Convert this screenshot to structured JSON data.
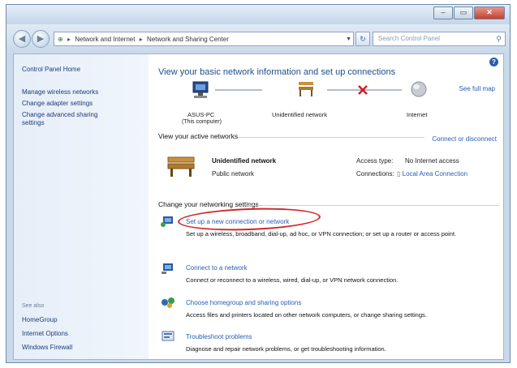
{
  "window": {
    "minimize_label": "–",
    "maximize_label": "▭",
    "close_label": "✕"
  },
  "address": {
    "crumbs": [
      "Network and Internet",
      "Network and Sharing Center"
    ],
    "search_placeholder": "Search Control Panel"
  },
  "sidebar": {
    "home": "Control Panel Home",
    "links": [
      "Manage wireless networks",
      "Change adapter settings",
      "Change advanced sharing",
      "settings"
    ],
    "see_also_label": "See also",
    "see_also": [
      "HomeGroup",
      "Internet Options",
      "Windows Firewall"
    ]
  },
  "main": {
    "heading": "View your basic network information and set up connections",
    "see_full_map": "See full map",
    "map": {
      "computer_name": "ASUS-PC",
      "computer_sub": "(This computer)",
      "network_name": "Unidentified network",
      "internet": "Internet"
    },
    "active_title": "View your active networks",
    "connect_disconnect": "Connect or disconnect",
    "active_network": {
      "name": "Unidentified network",
      "type": "Public network",
      "access_type_label": "Access type:",
      "access_type_value": "No Internet access",
      "connections_label": "Connections:",
      "connections_value": "Local Area Connection"
    },
    "change_title": "Change your networking settings",
    "tasks": [
      {
        "title": "Set up a new connection or network",
        "desc": "Set up a wireless, broadband, dial-up, ad hoc, or VPN connection; or set up a router or access point."
      },
      {
        "title": "Connect to a network",
        "desc": "Connect or reconnect to a wireless, wired, dial-up, or VPN network connection."
      },
      {
        "title": "Choose homegroup and sharing options",
        "desc": "Access files and printers located on other network computers, or change sharing settings."
      },
      {
        "title": "Troubleshoot problems",
        "desc": "Diagnose and repair network problems, or get troubleshooting information."
      }
    ]
  },
  "colors": {
    "link": "#2a5db0",
    "heading": "#1e4d8c",
    "highlight_oval": "#d02828"
  }
}
